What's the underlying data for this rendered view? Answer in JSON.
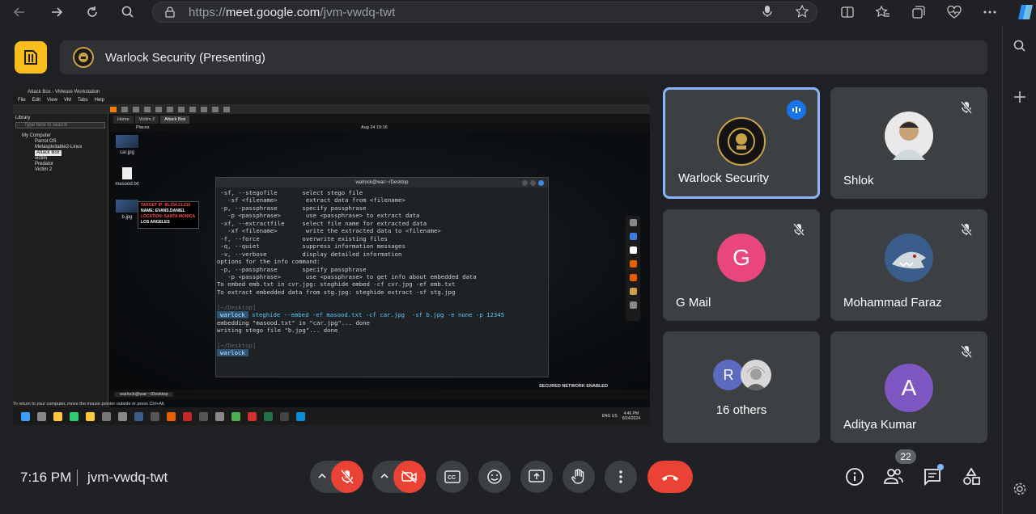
{
  "browser": {
    "url_prefix": "https://",
    "url_host": "meet.google.com",
    "url_path": "/jvm-vwdq-twt",
    "icons": [
      "back-icon",
      "forward-icon",
      "reload-icon",
      "search-icon",
      "lock-icon",
      "microphone-icon",
      "star-icon",
      "split-screen-icon",
      "favorites-icon",
      "collections-icon",
      "health-icon",
      "more-icon",
      "copilot-icon"
    ]
  },
  "presenting": {
    "label": "Warlock Security (Presenting)"
  },
  "vm": {
    "window_title": "Attack Box - VMware Workstation",
    "menu": [
      "File",
      "Edit",
      "View",
      "VM",
      "Tabs",
      "Help"
    ],
    "library_title": "Library",
    "library_search": "Type here to search",
    "library_items": [
      "My Computer",
      "Parrot OS",
      "Metasploitable2-Linux",
      "Attack Box",
      "victim",
      "Predator",
      "Victim 2"
    ],
    "tabs": [
      "Home",
      "Victim 2",
      "Attack Box"
    ],
    "places": "Places",
    "clock": "Aug 24  19:16",
    "desktop_icons": [
      "car.jpg",
      "masood.txt",
      "b.jpg"
    ],
    "terminal_title": "warlock@war:~/Desktop",
    "secured_network": "SECURED NETWORK ENABLED",
    "taskbar_item": "warlock@war:~/Desktop",
    "return_msg": "To return to your computer, move the mouse pointer outside or press Ctrl+Alt.",
    "sys_lang": "ENG US",
    "sys_time": "4:46 PM",
    "sys_date": "8/24/2024",
    "target_card": [
      "TARGET IP: 85.154.21.216",
      "NAME: EVANS.DANIEL",
      "LOCATION: SANTA MONICA",
      "LOS ANGELES"
    ]
  },
  "terminal": {
    "lines": [
      " -sf, --stegofile       select stego file",
      "   -sf <filename>        extract data from <filename>",
      " -p, --passphrase       specify passphrase",
      "   -p <passphrase>       use <passphrase> to extract data",
      " -xf, --extractfile     select file name for extracted data",
      "   -xf <filename>        write the extracted data to <filename>",
      " -f, --force            overwrite existing files",
      " -q, --quiet            suppress information messages",
      " -v, --verbose          display detailed information",
      "",
      "options for the info command:",
      " -p, --passphrase       specify passphrase",
      "   -p <passphrase>       use <passphrase> to get info about embedded data",
      "",
      "To embed emb.txt in cvr.jpg: steghide embed -cf cvr.jpg -ef emb.txt",
      "To extract embedded data from stg.jpg: steghide extract -sf stg.jpg"
    ],
    "prompt_dir": "[~/Desktop]",
    "prompt_user": "warlock",
    "command": "steghide --embed -ef masood.txt -cf car.jpg  -sf b.jpg -e none -p 12345",
    "output": [
      "embedding \"masood.txt\" in \"car.jpg\"... done",
      "writing stego file \"b.jpg\"... done"
    ],
    "prompt_dir2": "[~/Desktop]",
    "prompt_user2": "warlock"
  },
  "participants": [
    {
      "name": "Warlock Security",
      "avatar_color": "#1a1a1a",
      "speaking": true
    },
    {
      "name": "Shlok",
      "avatar_color": "#c9a27a",
      "muted": true
    },
    {
      "name": "G Mail",
      "initial": "G",
      "avatar_color": "#e8467c",
      "muted": true
    },
    {
      "name": "Mohammad Faraz",
      "avatar_color": "#3b5d8c",
      "muted": true
    },
    {
      "name": "16 others",
      "initial": "R",
      "avatar_color": "#5c6bc0"
    },
    {
      "name": "Aditya Kumar",
      "initial": "A",
      "avatar_color": "#7e57c2",
      "muted": true
    }
  ],
  "bottom": {
    "time": "7:16 PM",
    "meeting_code": "jvm-vwdq-twt",
    "people_count": "22"
  },
  "colors": {
    "accent": "#8ab4f8",
    "danger": "#ea4335",
    "logo": "#f9bd1c"
  }
}
